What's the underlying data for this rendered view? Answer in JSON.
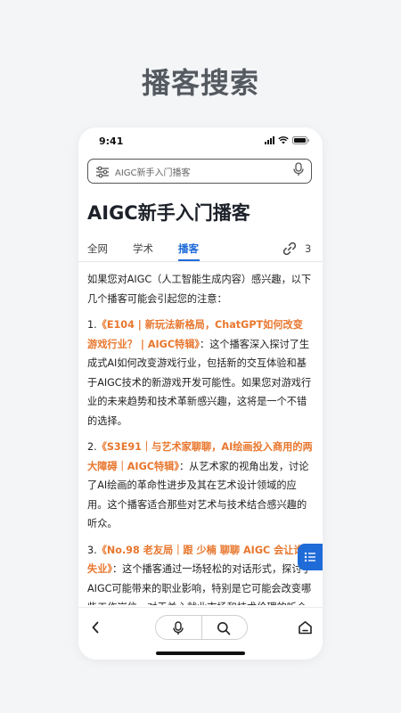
{
  "promo_title": "播客搜索",
  "status": {
    "time": "9:41"
  },
  "search": {
    "query": "AIGC新手入门播客"
  },
  "page_title": "AIGC新手入门播客",
  "tabs": [
    {
      "label": "全网"
    },
    {
      "label": "学术"
    },
    {
      "label": "播客"
    }
  ],
  "source_count": "3",
  "content": {
    "intro": "如果您对AIGC（人工智能生成内容）感兴趣，以下几个播客可能会引起您的注意：",
    "items": [
      {
        "num": "1.",
        "title": "《E104 | 新玩法新格局，ChatGPT如何改变游戏行业？ | AIGC特辑》",
        "desc": "：这个播客深入探讨了生成式AI如何改变游戏行业，包括新的交互体验和基于AIGC技术的新游戏开发可能性。如果您对游戏行业的未来趋势和技术革新感兴趣，这将是一个不错的选择。"
      },
      {
        "num": "2.",
        "title": "《S3E91｜与艺术家聊聊，AI绘画投入商用的两大障碍｜AIGC特辑》",
        "desc": "：从艺术家的视角出发，讨论了AI绘画的革命性进步及其在艺术设计领域的应用。这个播客适合那些对艺术与技术结合感兴趣的听众。"
      },
      {
        "num": "3.",
        "title": "《No.98 老友局｜跟 少楠 聊聊 AIGC 会让谁失业》",
        "desc": "：这个播客通过一场轻松的对话形式，探讨了AIGC可能带来的职业影响，特别是它可能会改变哪些工作岗位。对于关心就业市场和技术伦理的听众来说，这是一个值得收听的节目。"
      }
    ]
  },
  "colors": {
    "accent": "#1f6bd8",
    "highlight": "#e8772e",
    "background": "#f4f5f7"
  },
  "icons": {
    "filter": "filter-icon",
    "mic": "mic-icon",
    "link": "link-icon",
    "list": "list-icon",
    "back": "back-icon",
    "search": "search-icon",
    "home": "home-icon"
  }
}
